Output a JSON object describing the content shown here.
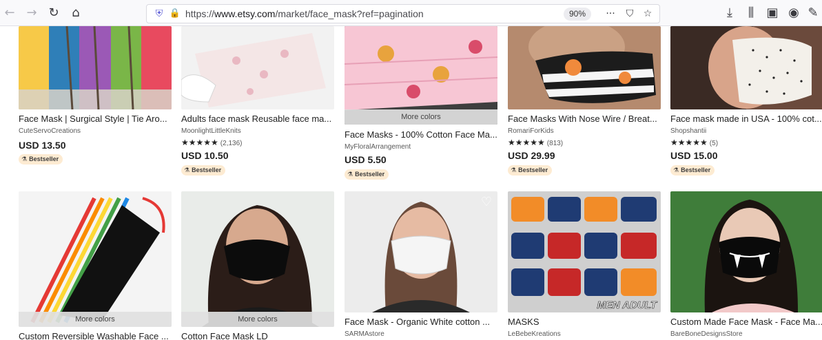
{
  "browser": {
    "url_prefix": "https://",
    "url_host": "www.etsy.com",
    "url_path": "/market/face_mask?ref=pagination",
    "zoom": "90%",
    "icons": {
      "back": "←",
      "forward": "→",
      "reload": "↻",
      "home": "⌂",
      "shield": "⛨",
      "lock": "🔒",
      "more": "···",
      "pocket": "⛉",
      "bookmark": "☆",
      "download": "⤓",
      "library": "⫼",
      "sidebar": "▣",
      "account": "◉",
      "extension": "✎"
    }
  },
  "products": [
    {
      "title": "Face Mask | Surgical Style | Tie Aro...",
      "shop": "CuteServoCreations",
      "price": "USD 13.50",
      "badge": "Bestseller",
      "colors": [
        "#f7c948",
        "#2f7fb8",
        "#9b59b6",
        "#7ab648",
        "#e84a5f"
      ]
    },
    {
      "title": "Adults face mask Reusable face ma...",
      "shop": "MoonlightLittleKnits",
      "stars": "★★★★★",
      "count": "(2,136)",
      "price": "USD 10.50",
      "badge": "Bestseller",
      "colors": [
        "#f4e6e6",
        "#e9b8c2",
        "#ffffff"
      ]
    },
    {
      "more_colors": "More colors",
      "title": "Face Masks - 100% Cotton Face Ma...",
      "shop": "MyFloralArrangement",
      "price": "USD 5.50",
      "badge": "Bestseller",
      "colors": [
        "#f7c6d4",
        "#e8a33d",
        "#d94c6a"
      ]
    },
    {
      "title": "Face Masks With Nose Wire / Breat...",
      "shop": "RomariForKids",
      "stars": "★★★★★",
      "count": "(813)",
      "price": "USD 29.99",
      "badge": "Bestseller",
      "colors": [
        "#1c1c1c",
        "#f08a3c",
        "#f5f5f5"
      ]
    },
    {
      "title": "Face mask made in USA - 100% cot...",
      "shop": "Shopshantii",
      "stars": "★★★★★",
      "count": "(5)",
      "price": "USD 15.00",
      "badge": "Bestseller",
      "colors": [
        "#f3f0ea",
        "#3a2a24",
        "#6b4a3c"
      ]
    },
    {
      "more_colors": "More colors",
      "title": "Custom Reversible Washable Face ...",
      "colors": [
        "#111111",
        "#e53935",
        "#1e88e5"
      ]
    },
    {
      "more_colors": "More colors",
      "title": "Cotton Face Mask LD",
      "colors": [
        "#0c0c0c",
        "#e9ece9",
        "#2b1d18"
      ]
    },
    {
      "title": "Face Mask - Organic White cotton ...",
      "shop": "SARMAstore",
      "colors": [
        "#f5f5f5",
        "#6a4a3a",
        "#9a9a9a"
      ]
    },
    {
      "title": "MASKS",
      "shop": "LeBebeKreations",
      "colors": [
        "#f28c28",
        "#1f3b73",
        "#c62828"
      ],
      "image_text": "MEN ADULT"
    },
    {
      "title": "Custom Made Face Mask - Face Ma...",
      "shop": "BareBoneDesignsStore",
      "colors": [
        "#0a0a0a",
        "#3f7d3a",
        "#e9c9b6"
      ]
    }
  ]
}
